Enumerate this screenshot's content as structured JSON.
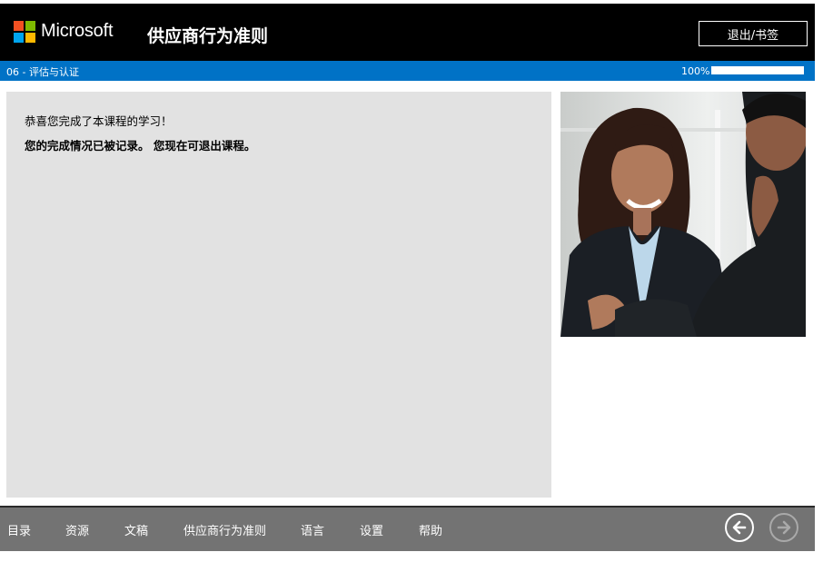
{
  "header": {
    "brand": "Microsoft",
    "course_title": "供应商行为准则",
    "exit_label": "退出/书签"
  },
  "status_bar": {
    "section": "06 - 评估与认证",
    "progress_text": "100%",
    "progress_fraction": 1.0
  },
  "content": {
    "message_line1": "恭喜您完成了本课程的学习！",
    "message_line2": "您的完成情况已被记录。 您现在可退出课程。"
  },
  "footer": {
    "nav": [
      "目录",
      "资源",
      "文稿",
      "供应商行为准则",
      "语言",
      "设置",
      "帮助"
    ],
    "back_icon": "arrow-left-circle-icon",
    "next_icon": "arrow-right-circle-icon"
  },
  "colors": {
    "header_bg": "#000000",
    "accent_blue": "#0072c6",
    "content_bg": "#e2e2e2",
    "footer_bg": "#737373",
    "logo_red": "#f25022",
    "logo_green": "#7fba00",
    "logo_blue": "#00a4ef",
    "logo_yellow": "#ffb900"
  }
}
